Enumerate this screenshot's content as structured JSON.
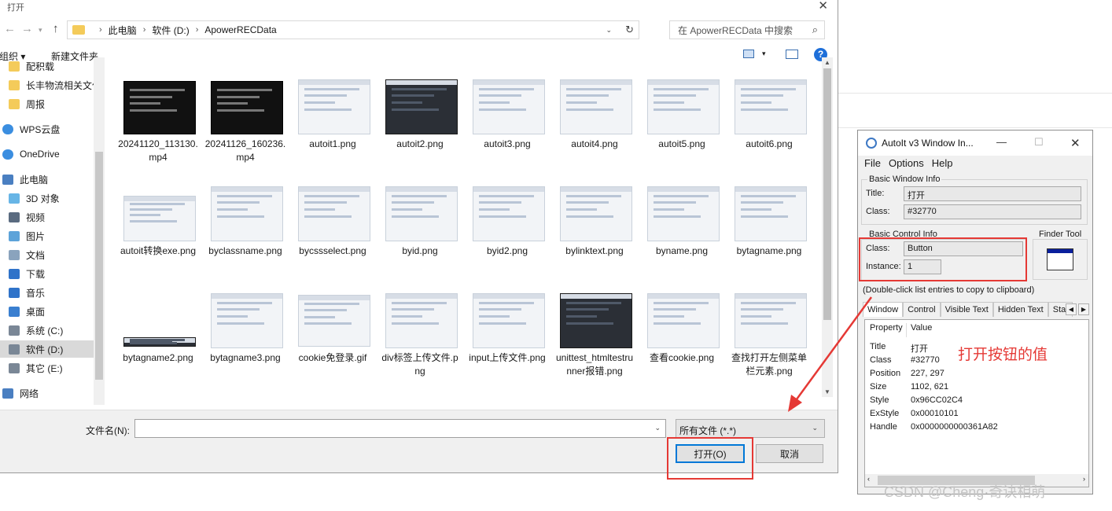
{
  "dialog": {
    "title": "打开",
    "path": [
      "此电脑",
      "软件 (D:)",
      "ApowerRECData"
    ],
    "search_placeholder": "在 ApowerRECData 中搜索",
    "toolbar": {
      "organize": "组织",
      "new_folder": "新建文件夹"
    },
    "nav_items": [
      {
        "label": "配积载",
        "icon": "folder-icon"
      },
      {
        "label": "长丰物流相关文件",
        "icon": "folder-icon"
      },
      {
        "label": "周报",
        "icon": "folder-icon"
      },
      {
        "label": "WPS云盘",
        "icon": "cloud-icon"
      },
      {
        "label": "OneDrive",
        "icon": "cloud-icon"
      },
      {
        "label": "此电脑",
        "icon": "computer-icon"
      },
      {
        "label": "3D 对象",
        "icon": "cube-icon"
      },
      {
        "label": "视频",
        "icon": "video-icon"
      },
      {
        "label": "图片",
        "icon": "picture-icon"
      },
      {
        "label": "文档",
        "icon": "document-icon"
      },
      {
        "label": "下载",
        "icon": "download-icon"
      },
      {
        "label": "音乐",
        "icon": "music-icon"
      },
      {
        "label": "桌面",
        "icon": "desktop-icon"
      },
      {
        "label": "系统 (C:)",
        "icon": "drive-icon"
      },
      {
        "label": "软件 (D:)",
        "icon": "drive-icon",
        "selected": true
      },
      {
        "label": "其它 (E:)",
        "icon": "drive-icon"
      },
      {
        "label": "网络",
        "icon": "network-icon"
      }
    ],
    "files": [
      {
        "name": "20241120_113130.mp4",
        "kind": "film"
      },
      {
        "name": "20241126_160236.mp4",
        "kind": "film"
      },
      {
        "name": "autoit1.png",
        "kind": "light"
      },
      {
        "name": "autoit2.png",
        "kind": "dark"
      },
      {
        "name": "autoit3.png",
        "kind": "light"
      },
      {
        "name": "autoit4.png",
        "kind": "light"
      },
      {
        "name": "autoit5.png",
        "kind": "light"
      },
      {
        "name": "autoit6.png",
        "kind": "light"
      },
      {
        "name": "autoit转换exe.png",
        "kind": "light"
      },
      {
        "name": "byclassname.png",
        "kind": "light"
      },
      {
        "name": "bycssselect.png",
        "kind": "light"
      },
      {
        "name": "byid.png",
        "kind": "light"
      },
      {
        "name": "byid2.png",
        "kind": "light"
      },
      {
        "name": "bylinktext.png",
        "kind": "light"
      },
      {
        "name": "byname.png",
        "kind": "light"
      },
      {
        "name": "bytagname.png",
        "kind": "light"
      },
      {
        "name": "bytagname2.png",
        "kind": "dark"
      },
      {
        "name": "bytagname3.png",
        "kind": "light"
      },
      {
        "name": "cookie免登录.gif",
        "kind": "light"
      },
      {
        "name": "div标签上传文件.png",
        "kind": "light"
      },
      {
        "name": "input上传文件.png",
        "kind": "light"
      },
      {
        "name": "unittest_htmltestrunner报错.png",
        "kind": "dark"
      },
      {
        "name": "查看cookie.png",
        "kind": "light"
      },
      {
        "name": "查找打开左侧菜单栏元素.png",
        "kind": "light"
      }
    ],
    "filename_label": "文件名(N):",
    "filename_value": "",
    "filetype": "所有文件 (*.*)",
    "open_button": "打开(O)",
    "cancel_button": "取消"
  },
  "autoit": {
    "title": "AutoIt v3 Window In...",
    "menu": [
      "File",
      "Options",
      "Help"
    ],
    "basic_window_info": "Basic Window Info",
    "window_title_label": "Title:",
    "window_title_value": "打开",
    "window_class_label": "Class:",
    "window_class_value": "#32770",
    "basic_control_info": "Basic Control Info",
    "control_class_label": "Class:",
    "control_class_value": "Button",
    "instance_label": "Instance:",
    "instance_value": "1",
    "finder_tool": "Finder Tool",
    "hint": "(Double-click list entries to copy to clipboard)",
    "tabs": [
      "Window",
      "Control",
      "Visible Text",
      "Hidden Text",
      "Stat"
    ],
    "columns": [
      "Property",
      "Value"
    ],
    "rows": [
      [
        "Title",
        "打开"
      ],
      [
        "Class",
        "#32770"
      ],
      [
        "Position",
        "227, 297"
      ],
      [
        "Size",
        "1102, 621"
      ],
      [
        "Style",
        "0x96CC02C4"
      ],
      [
        "ExStyle",
        "0x00010101"
      ],
      [
        "Handle",
        "0x0000000000361A82"
      ]
    ]
  },
  "annotation": "打开按钮的值",
  "watermark": "CSDN @Cheng·奇诀相萌",
  "colors": {
    "highlight": "#e53935",
    "accent": "#0078d7"
  }
}
